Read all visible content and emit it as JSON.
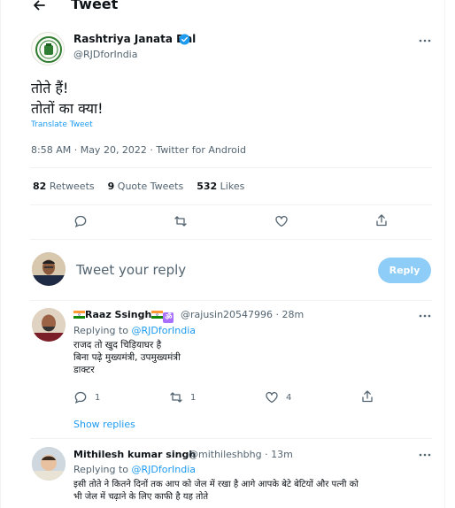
{
  "header": {
    "title": "Tweet",
    "back_icon": "arrow-left-icon"
  },
  "tweet": {
    "author_name": "Rashtriya Janata Dal",
    "author_handle": "@RJDforIndia",
    "text_line1": "तोते हैं!",
    "text_line2": "तोतों का क्या!",
    "translate_label": "Translate Tweet",
    "meta": "8:58 AM · May 20, 2022 · Twitter for Android",
    "retweets_count": "82",
    "retweets_label": "Retweets",
    "quotes_count": "9",
    "quotes_label": "Quote Tweets",
    "likes_count": "532",
    "likes_label": "Likes"
  },
  "composer": {
    "placeholder": "Tweet your reply",
    "button_label": "Reply"
  },
  "replies": [
    {
      "name": "Raaz Ssingh",
      "handle": "@rajusin20547996",
      "time": "· 28m",
      "replying_prefix": "Replying to",
      "replying_to": "@RJDforIndia",
      "line1": "राजद तो खुद चिड़ियाघर है",
      "line2": "बिना पढ़े मुख्यमंत्री, उपमुख्यमंत्री",
      "line3": "डाक्टर",
      "reply_count": "1",
      "retweet_count": "1",
      "like_count": "4",
      "show_replies": "Show replies"
    },
    {
      "name": "Mithilesh kumar singh",
      "handle": "@mithileshbhg",
      "time": "· 13m",
      "replying_prefix": "Replying to",
      "replying_to": "@RJDforIndia",
      "line1": "इसी तोते ने कितने दिनों तक आप को जेल में रखा है आगे आपके बेटे बेटियों और पत्नी को",
      "line2": "भी जेल में चढ़ाने के लिए काफी है यह तोते"
    }
  ],
  "colors": {
    "accent": "#1d9bf0",
    "muted": "#536471",
    "reply_button": "#8ecdf7",
    "verified": "#1d9bf0"
  }
}
